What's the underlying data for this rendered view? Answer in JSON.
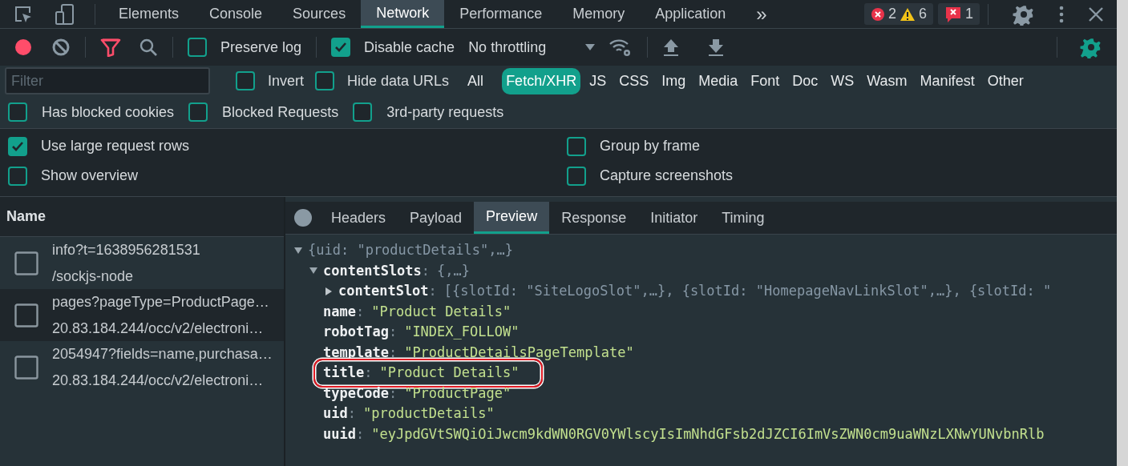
{
  "main_tabs": [
    {
      "label": "Elements",
      "selected": false
    },
    {
      "label": "Console",
      "selected": false
    },
    {
      "label": "Sources",
      "selected": false
    },
    {
      "label": "Network",
      "selected": true
    },
    {
      "label": "Performance",
      "selected": false
    },
    {
      "label": "Memory",
      "selected": false
    },
    {
      "label": "Application",
      "selected": false
    }
  ],
  "more_tabs": "»",
  "counters": {
    "errors": "2",
    "warnings": "6",
    "issues": "1"
  },
  "toolbar": {
    "recording": true,
    "filter_active": true,
    "preserve_log": {
      "label": "Preserve log",
      "checked": false
    },
    "disable_cache": {
      "label": "Disable cache",
      "checked": true
    },
    "throttling": "No throttling"
  },
  "filter": {
    "placeholder": "Filter"
  },
  "filter_options": [
    {
      "label": "Invert",
      "checked": false
    },
    {
      "label": "Hide data URLs",
      "checked": false
    }
  ],
  "type_filters": [
    {
      "label": "All",
      "selected": false
    },
    {
      "label": "Fetch/XHR",
      "selected": true
    },
    {
      "label": "JS",
      "selected": false
    },
    {
      "label": "CSS",
      "selected": false
    },
    {
      "label": "Img",
      "selected": false
    },
    {
      "label": "Media",
      "selected": false
    },
    {
      "label": "Font",
      "selected": false
    },
    {
      "label": "Doc",
      "selected": false
    },
    {
      "label": "WS",
      "selected": false
    },
    {
      "label": "Wasm",
      "selected": false
    },
    {
      "label": "Manifest",
      "selected": false
    },
    {
      "label": "Other",
      "selected": false
    }
  ],
  "request_filters": [
    {
      "label": "Has blocked cookies",
      "checked": false
    },
    {
      "label": "Blocked Requests",
      "checked": false
    },
    {
      "label": "3rd-party requests",
      "checked": false
    }
  ],
  "settings": [
    {
      "label": "Use large request rows",
      "checked": true
    },
    {
      "label": "Group by frame",
      "checked": false
    },
    {
      "label": "Show overview",
      "checked": false
    },
    {
      "label": "Capture screenshots",
      "checked": false
    }
  ],
  "requests": {
    "column": "Name",
    "rows": [
      {
        "name": "info?t=1638956281531",
        "path": "/sockjs-node",
        "selected": false
      },
      {
        "name": "pages?pageType=ProductPage…",
        "path": "20.83.184.244/occ/v2/electroni…",
        "selected": true
      },
      {
        "name": "2054947?fields=name,purchasa…",
        "path": "20.83.184.244/occ/v2/electroni…",
        "selected": false
      }
    ]
  },
  "detail_tabs": [
    {
      "label": "Headers",
      "selected": false
    },
    {
      "label": "Payload",
      "selected": false
    },
    {
      "label": "Preview",
      "selected": true
    },
    {
      "label": "Response",
      "selected": false
    },
    {
      "label": "Initiator",
      "selected": false
    },
    {
      "label": "Timing",
      "selected": false
    }
  ],
  "preview": {
    "summary": "{uid: \"productDetails\",…}",
    "expanded": true,
    "children": [
      {
        "key": "contentSlots",
        "colon": ":",
        "summary": "{,…}",
        "expanded": true,
        "children": [
          {
            "key": "contentSlot",
            "colon": ":",
            "summary": "[{slotId: \"SiteLogoSlot\",…}, {slotId: \"HomepageNavLinkSlot\",…}, {slotId: \"",
            "expanded": false
          }
        ]
      },
      {
        "key": "name",
        "colon": ":",
        "value": "\"Product Details\""
      },
      {
        "key": "robotTag",
        "colon": ":",
        "value": "\"INDEX_FOLLOW\""
      },
      {
        "key": "template",
        "colon": ":",
        "value": "\"ProductDetailsPageTemplate\""
      },
      {
        "key": "title",
        "colon": ":",
        "value": "\"Product Details\"",
        "highlighted": true
      },
      {
        "key": "typeCode",
        "colon": ":",
        "value": "\"ProductPage\""
      },
      {
        "key": "uid",
        "colon": ":",
        "value": "\"productDetails\""
      },
      {
        "key": "uuid",
        "colon": ":",
        "value": "\"eyJpdGVtSWQiOiJwcm9kdWN0RGV0YWlscyIsImNhdGFsb2dJZCI6ImVsZWN0cm9uaWNzLXNwYUNvbnRlb"
      }
    ]
  }
}
